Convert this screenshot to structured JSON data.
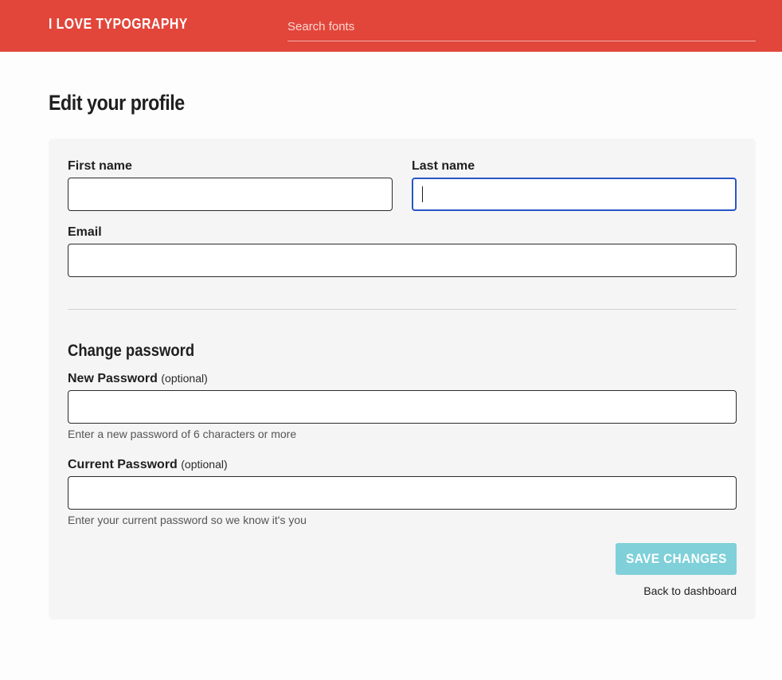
{
  "header": {
    "brand": "I LOVE TYPOGRAPHY",
    "search_placeholder": "Search fonts",
    "background_color": "#e2463a"
  },
  "page": {
    "title": "Edit your profile"
  },
  "form": {
    "first_name": {
      "label": "First name",
      "value": ""
    },
    "last_name": {
      "label": "Last name",
      "value": "",
      "focused": true
    },
    "email": {
      "label": "Email",
      "value": ""
    },
    "password_section_title": "Change password",
    "new_password": {
      "label": "New Password",
      "optional": "(optional)",
      "value": "",
      "hint": "Enter a new password of 6 characters or more"
    },
    "current_password": {
      "label": "Current Password",
      "optional": "(optional)",
      "value": "",
      "hint": "Enter your current password so we know it's you"
    },
    "save_label": "SAVE CHANGES",
    "save_color": "#7fd0d9",
    "back_label": "Back to dashboard",
    "focus_color": "#2857c7"
  }
}
